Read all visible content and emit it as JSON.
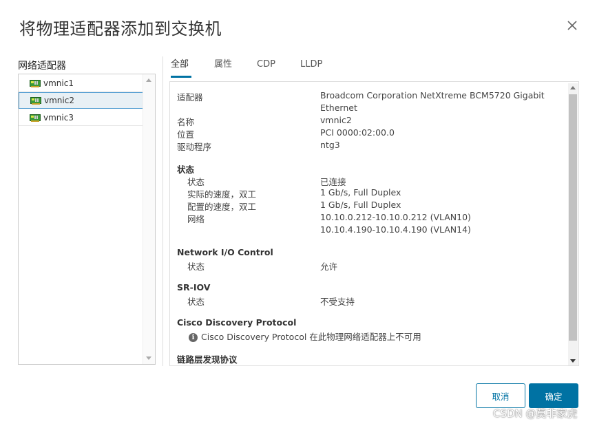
{
  "dialog": {
    "title": "将物理适配器添加到交换机"
  },
  "left_panel": {
    "label": "网络适配器",
    "adapters": [
      {
        "name": "vmnic1",
        "selected": false
      },
      {
        "name": "vmnic2",
        "selected": true
      },
      {
        "name": "vmnic3",
        "selected": false
      }
    ]
  },
  "tabs": [
    {
      "label": "全部",
      "active": true
    },
    {
      "label": "属性",
      "active": false
    },
    {
      "label": "CDP",
      "active": false
    },
    {
      "label": "LLDP",
      "active": false
    }
  ],
  "details": {
    "adapter_label": "适配器",
    "adapter_value_line1": "Broadcom Corporation NetXtreme BCM5720 Gigabit",
    "adapter_value_line2": "Ethernet",
    "name_label": "名称",
    "name_value": "vmnic2",
    "location_label": "位置",
    "location_value": "PCI 0000:02:00.0",
    "driver_label": "驱动程序",
    "driver_value": "ntg3",
    "status_section": "状态",
    "status_label": "状态",
    "status_value": "已连接",
    "actual_speed_label": "实际的速度，双工",
    "actual_speed_value": "1 Gb/s, Full Duplex",
    "config_speed_label": "配置的速度，双工",
    "config_speed_value": "1 Gb/s, Full Duplex",
    "network_label": "网络",
    "network_value_1": "10.10.0.212-10.10.0.212 (VLAN10)",
    "network_value_2": "10.10.4.190-10.10.4.190 (VLAN14)",
    "nioc_section": "Network I/O Control",
    "nioc_status_label": "状态",
    "nioc_status_value": "允许",
    "sriov_section": "SR-IOV",
    "sriov_status_label": "状态",
    "sriov_status_value": "不受支持",
    "cdp_section": "Cisco Discovery Protocol",
    "cdp_message": "Cisco Discovery Protocol 在此物理网络适配器上不可用",
    "lldp_section": "链路层发现协议"
  },
  "buttons": {
    "cancel": "取消",
    "ok": "确定"
  },
  "watermark": "CSDN @莫非家虎",
  "colors": {
    "accent": "#0072a3",
    "selected_bg": "#e8f0f5"
  }
}
